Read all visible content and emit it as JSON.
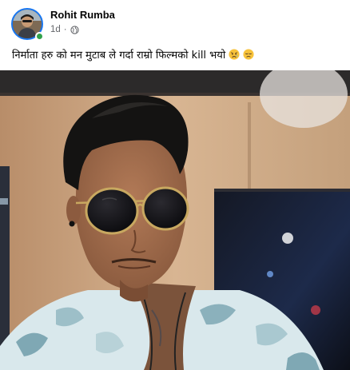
{
  "post": {
    "author": "Rohit Rumba",
    "time": "1d",
    "separator": "·",
    "privacy_icon": "globe-icon",
    "caption_text": "निर्माता हरु को मन मुटाब ले गर्दा राम्रो फिल्मको kill भयो",
    "caption_emojis": [
      "sad-but-relieved-emoji",
      "disappointed-emoji"
    ]
  },
  "colors": {
    "accent": "#1877f2",
    "online": "#31a24c",
    "text": "#050505",
    "secondary_text": "#65676b"
  }
}
